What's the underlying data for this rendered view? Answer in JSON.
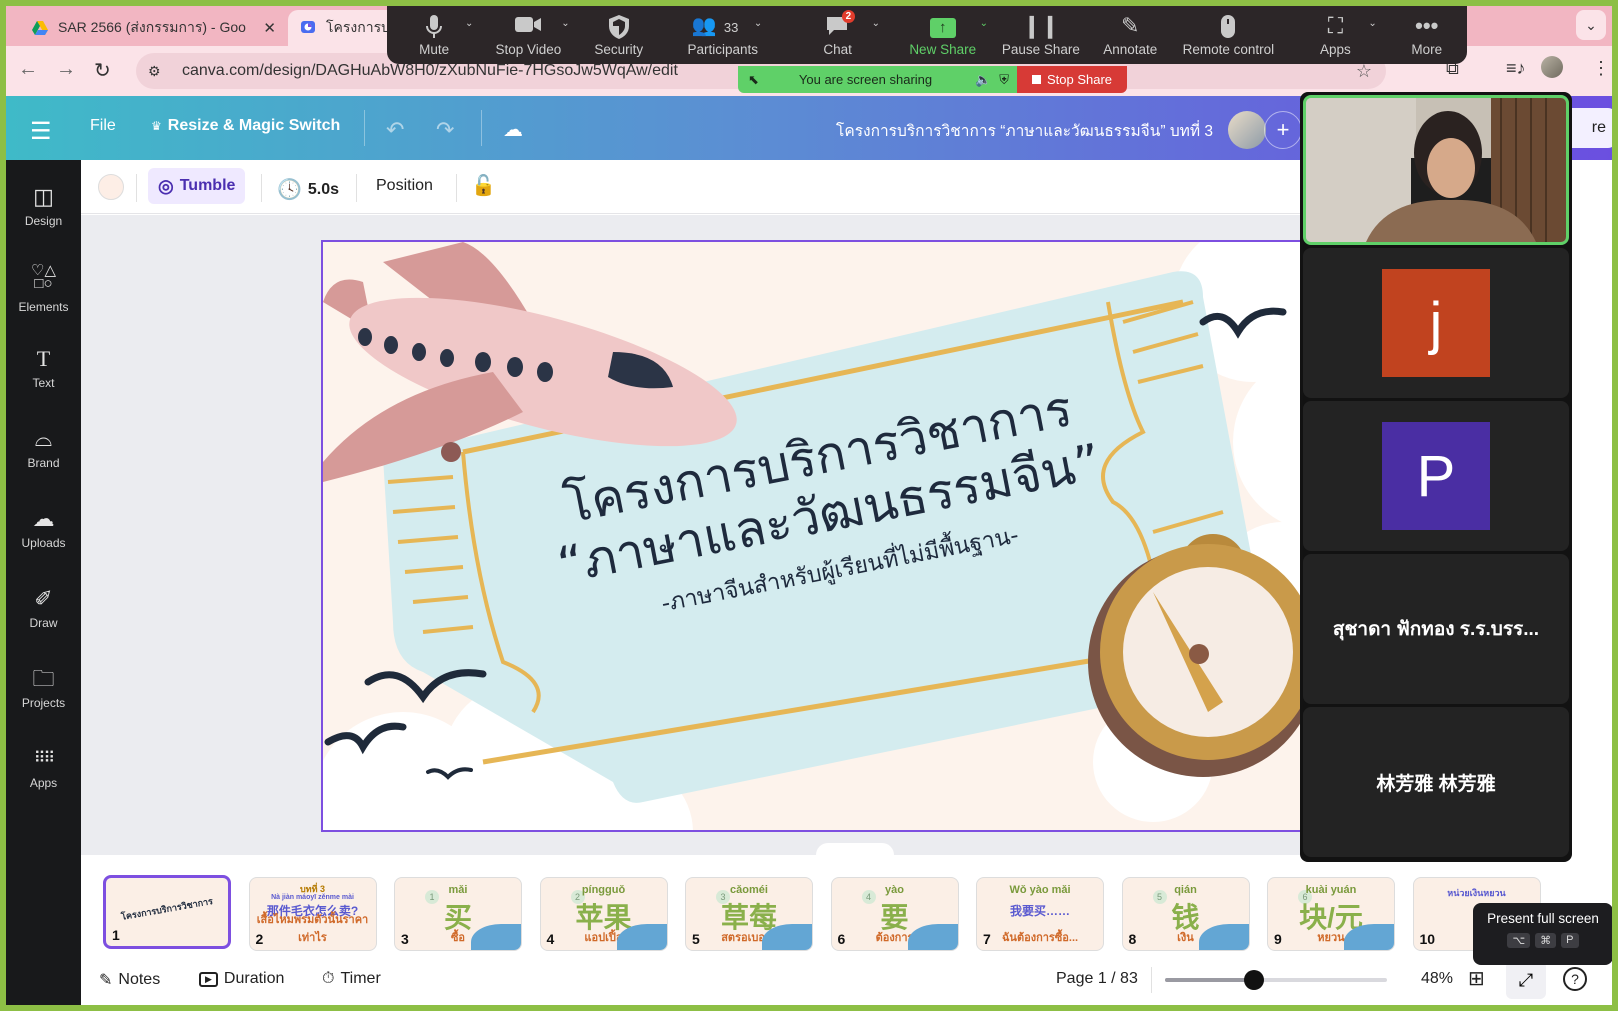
{
  "browser": {
    "tabs": [
      {
        "label": "SAR 2566 (ส่งกรรมการ) - Goo",
        "icon": "google-drive-icon",
        "active": false
      },
      {
        "label": "โครงการบริ",
        "icon": "canva-present-icon",
        "active": true
      }
    ],
    "url": "canva.com/design/DAGHuAbW8H0/zXubNuFie-7HGsoJw5WqAw/edit"
  },
  "zoom_toolbar": {
    "buttons": [
      {
        "label": "Mute",
        "icon": "microphone-icon",
        "caret": true
      },
      {
        "label": "Stop Video",
        "icon": "video-camera-icon",
        "caret": true
      },
      {
        "label": "Security",
        "icon": "shield-icon",
        "caret": false
      },
      {
        "label": "Participants",
        "icon": "participants-icon",
        "count": "33",
        "caret": true
      },
      {
        "label": "Chat",
        "icon": "chat-icon",
        "badge": "2",
        "caret": true
      },
      {
        "label": "New Share",
        "icon": "share-up-arrow-icon",
        "caret": true
      },
      {
        "label": "Pause Share",
        "icon": "pause-icon",
        "caret": false
      },
      {
        "label": "Annotate",
        "icon": "pencil-icon",
        "caret": false
      },
      {
        "label": "Remote control",
        "icon": "mouse-icon",
        "caret": false
      },
      {
        "label": "Apps",
        "icon": "apps-icon",
        "caret": true
      },
      {
        "label": "More",
        "icon": "more-dots-icon",
        "caret": false
      }
    ],
    "sharing_status": "You are screen sharing",
    "stop_share": "Stop Share"
  },
  "canva": {
    "header": {
      "file": "File",
      "resize": "Resize & Magic Switch",
      "doc_title": "โครงการบริการวิชาการ “ภาษาและวัฒนธรรมจีน” บทที่ 3",
      "share": "re"
    },
    "rail": [
      {
        "label": "Design",
        "icon": "design-icon"
      },
      {
        "label": "Elements",
        "icon": "elements-icon"
      },
      {
        "label": "Text",
        "icon": "text-icon"
      },
      {
        "label": "Brand",
        "icon": "brand-icon"
      },
      {
        "label": "Uploads",
        "icon": "uploads-icon"
      },
      {
        "label": "Draw",
        "icon": "draw-icon"
      },
      {
        "label": "Projects",
        "icon": "projects-icon"
      },
      {
        "label": "Apps",
        "icon": "apps-grid-icon"
      }
    ],
    "context_toolbar": {
      "background_color": "#fdeee6",
      "animation": "Tumble",
      "duration": "5.0s",
      "position": "Position"
    },
    "slide": {
      "title_line1": "โครงการบริการวิชาการ",
      "title_line2": "“ภาษาและวัฒนธรรมจีน”",
      "subtitle": "-ภาษาจีนสำหรับผู้เรียนที่ไม่มีพื้นฐาน-"
    },
    "thumbnails": [
      {
        "num": "1",
        "pinyin": "",
        "hanzi": "",
        "thai": "โครงการบริการวิชาการ",
        "selected": true
      },
      {
        "num": "2",
        "pinyin": "Nà jiàn máoyī zěnme mài",
        "hanzi": "那件毛衣怎么卖?",
        "thai": "เสื้อไหมพรมตัวนั้นราคาเท่าไร",
        "header": "บทที่ 3"
      },
      {
        "num": "3",
        "idx": "1",
        "pinyin": "mǎi",
        "hanzi": "买",
        "thai": "ซื้อ"
      },
      {
        "num": "4",
        "idx": "2",
        "pinyin": "píngguǒ",
        "hanzi": "苹果",
        "thai": "แอปเปิ้ล"
      },
      {
        "num": "5",
        "idx": "3",
        "pinyin": "cǎoméi",
        "hanzi": "草莓",
        "thai": "สตรอเบอร์รี่"
      },
      {
        "num": "6",
        "idx": "4",
        "pinyin": "yào",
        "hanzi": "要",
        "thai": "ต้องการ"
      },
      {
        "num": "7",
        "pinyin": "Wǒ yào mǎi",
        "hanzi": "我要买……",
        "thai": "ฉันต้องการซื้อ..."
      },
      {
        "num": "8",
        "idx": "5",
        "pinyin": "qián",
        "hanzi": "钱",
        "thai": "เงิน"
      },
      {
        "num": "9",
        "idx": "6",
        "pinyin": "kuài   yuán",
        "hanzi": "块/元",
        "thai": "หยวน"
      },
      {
        "num": "10",
        "pinyin": "",
        "hanzi": "",
        "thai": "หน่วยเงินหยวน"
      }
    ],
    "bottom": {
      "notes": "Notes",
      "duration": "Duration",
      "timer": "Timer",
      "page": "Page 1 / 83",
      "zoom_percent": "48%",
      "zoom_value": 48
    },
    "tooltip": {
      "label": "Present full screen",
      "keys": [
        "⌥",
        "⌘",
        "P"
      ]
    }
  },
  "participants_panel": {
    "tiles": [
      {
        "type": "video",
        "name": "active speaker video"
      },
      {
        "type": "avatar",
        "initial": "j",
        "color": "#c1431f"
      },
      {
        "type": "avatar",
        "initial": "P",
        "color": "#4a2ea3"
      },
      {
        "type": "name",
        "name": "สุชาดา ฟักทอง ร.ร.บรร..."
      },
      {
        "type": "name",
        "name": "林芳雅 林芳雅"
      }
    ]
  }
}
